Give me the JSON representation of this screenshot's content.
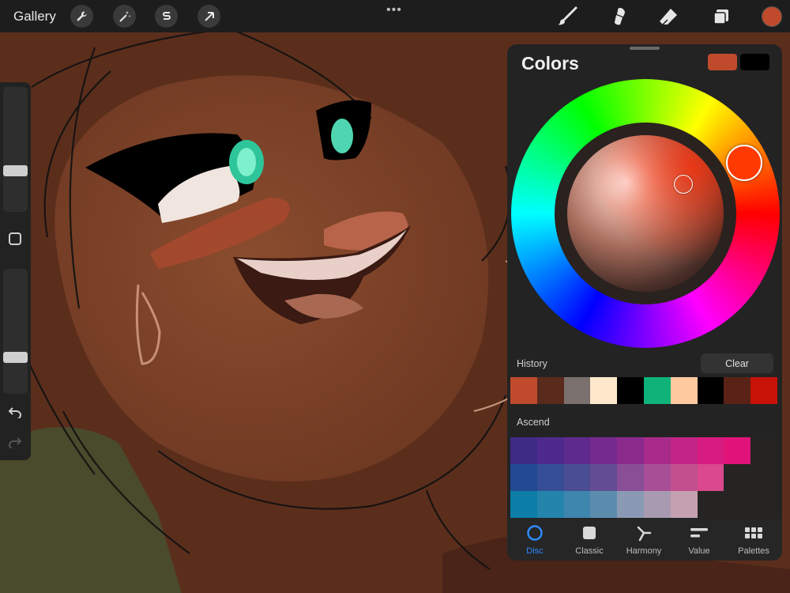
{
  "toolbar": {
    "gallery_label": "Gallery",
    "left_tools": [
      "wrench-icon",
      "magic-wand-icon",
      "selection-s-icon",
      "arrow-icon"
    ],
    "more_label": "•••",
    "right_tools": [
      "brush-icon",
      "smudge-icon",
      "eraser-icon",
      "layers-icon"
    ],
    "current_color": "#c04a2c"
  },
  "colors_panel": {
    "title": "Colors",
    "primary_swatch": "#c04a2c",
    "secondary_swatch": "#000000",
    "history_label": "History",
    "clear_label": "Clear",
    "history": [
      "#c04a2c",
      "#5a2a1c",
      "#7a706e",
      "#fde8cc",
      "#000000",
      "#0fb37a",
      "#ffc9a0",
      "#000000",
      "#5a2216",
      "#c81208"
    ],
    "palette_label": "Ascend",
    "palette_rows": [
      [
        "#3e2b85",
        "#4e2a8c",
        "#5e2a8e",
        "#752a8e",
        "#8c2a8c",
        "#a82a8a",
        "#c22586",
        "#d61c80",
        "#e01478"
      ],
      [
        "#224a92",
        "#354e96",
        "#4a4d94",
        "#634c94",
        "#8a4e96",
        "#a84e96",
        "#c2508e",
        "#da488e"
      ],
      [
        "#0c7ea8",
        "#2484ac",
        "#3e86ae",
        "#5c8cae",
        "#8a9ab4",
        "#a89ab0",
        "#c4a0b0"
      ]
    ],
    "tabs": [
      {
        "label": "Disc",
        "icon": "disc-icon",
        "active": true
      },
      {
        "label": "Classic",
        "icon": "classic-square-icon",
        "active": false
      },
      {
        "label": "Harmony",
        "icon": "harmony-icon",
        "active": false
      },
      {
        "label": "Value",
        "icon": "value-sliders-icon",
        "active": false
      },
      {
        "label": "Palettes",
        "icon": "palettes-grid-icon",
        "active": false
      }
    ]
  },
  "sidebar": {
    "icons": [
      "brush-size-slider",
      "modify-button-icon",
      "opacity-slider",
      "undo-icon",
      "redo-icon"
    ]
  }
}
